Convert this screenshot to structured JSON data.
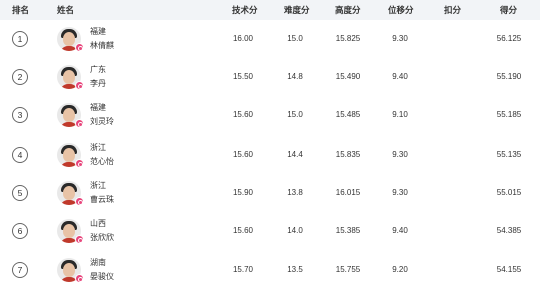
{
  "header": {
    "rank": "排名",
    "name": "姓名",
    "technique": "技术分",
    "difficulty": "难度分",
    "height": "高度分",
    "displacement": "位移分",
    "deduction": "扣分",
    "total": "得分"
  },
  "rows": [
    {
      "rank": "1",
      "province": "福建",
      "name": "林倩麒",
      "technique": "16.00",
      "difficulty": "15.0",
      "height": "15.825",
      "displacement": "9.30",
      "deduction": "",
      "total": "56.125"
    },
    {
      "rank": "2",
      "province": "广东",
      "name": "李丹",
      "technique": "15.50",
      "difficulty": "14.8",
      "height": "15.490",
      "displacement": "9.40",
      "deduction": "",
      "total": "55.190"
    },
    {
      "rank": "3",
      "province": "福建",
      "name": "刘灵玲",
      "technique": "15.60",
      "difficulty": "15.0",
      "height": "15.485",
      "displacement": "9.10",
      "deduction": "",
      "total": "55.185"
    },
    {
      "rank": "4",
      "province": "浙江",
      "name": "范心怡",
      "technique": "15.60",
      "difficulty": "14.4",
      "height": "15.835",
      "displacement": "9.30",
      "deduction": "",
      "total": "55.135"
    },
    {
      "rank": "5",
      "province": "浙江",
      "name": "曹云珠",
      "technique": "15.90",
      "difficulty": "13.8",
      "height": "16.015",
      "displacement": "9.30",
      "deduction": "",
      "total": "55.015"
    },
    {
      "rank": "6",
      "province": "山西",
      "name": "张欣欣",
      "technique": "15.60",
      "difficulty": "14.0",
      "height": "15.385",
      "displacement": "9.40",
      "deduction": "",
      "total": "54.385"
    },
    {
      "rank": "7",
      "province": "湖南",
      "name": "晏骏仪",
      "technique": "15.70",
      "difficulty": "13.5",
      "height": "15.755",
      "displacement": "9.20",
      "deduction": "",
      "total": "54.155"
    }
  ]
}
